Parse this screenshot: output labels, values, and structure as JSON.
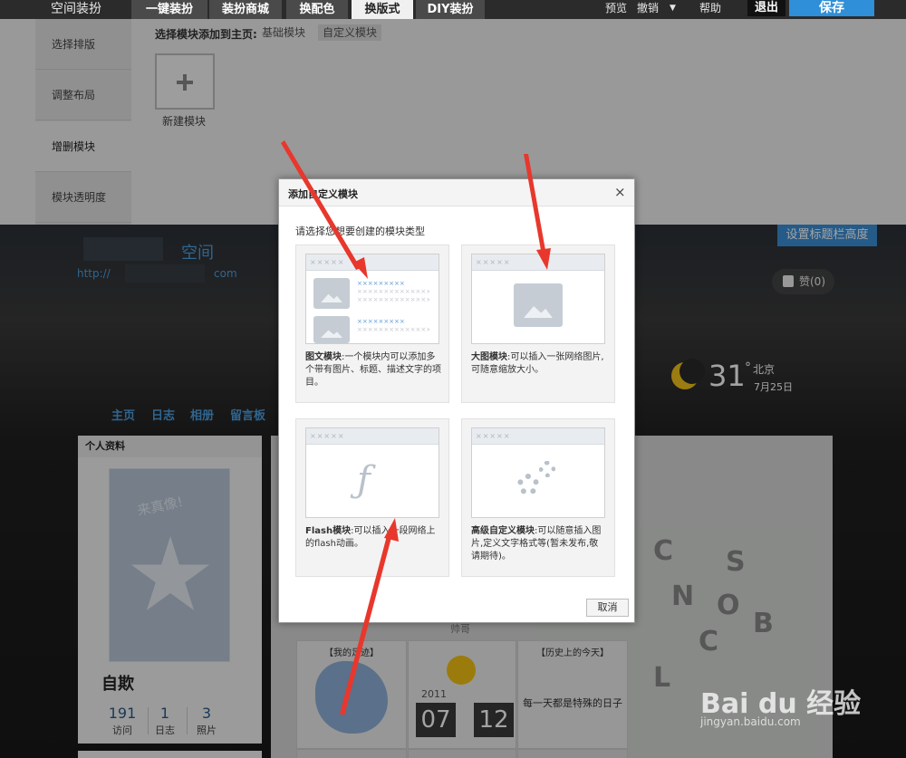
{
  "topbar": {
    "brand": "空间装扮",
    "tabs": [
      "一键装扮",
      "装扮商城",
      "换配色",
      "换版式",
      "DIY装扮"
    ],
    "active_tab": "换版式",
    "preview": "预览",
    "undo": "撤销",
    "help": "帮助",
    "exit": "退出",
    "save": "保存"
  },
  "panel": {
    "side_items": [
      "选择排版",
      "调整布局",
      "增删模块",
      "模块透明度"
    ],
    "active_side": "增删模块",
    "hint": "选择模块添加到主页:",
    "chips": [
      "基础模块",
      "自定义模块"
    ],
    "new_module": "新建模块"
  },
  "space": {
    "title": "空间",
    "url_prefix": "http://",
    "url_suffix": "com",
    "set_height": "设置标题栏高度",
    "like": "赞(0)",
    "temp": "31",
    "deg": "°",
    "city": "北京",
    "date": "7月25日",
    "nav": [
      "主页",
      "日志",
      "相册",
      "留言板"
    ],
    "profile_head": "个人资料",
    "avatar_text": "来真像!",
    "name": "自欺",
    "stats": [
      {
        "num": "191",
        "label": "访问"
      },
      {
        "num": "1",
        "label": "日志"
      },
      {
        "num": "3",
        "label": "照片"
      }
    ],
    "tiles": {
      "t1": "【我的足迹】",
      "t2": "帅哥",
      "t3": "【历史上的今天】",
      "year": "2011",
      "month": "07",
      "day": "12",
      "history_note": "每一天都是特殊的日子"
    }
  },
  "dialog": {
    "title": "添加自定义模块",
    "close": "×",
    "hint": "请选择您想要创建的模块类型",
    "shot_bar": "×××××",
    "cards": [
      {
        "name": "图文模块",
        "desc": ":一个模块内可以添加多个带有图片、标题、描述文字的项目。"
      },
      {
        "name": "大图模块",
        "desc": ":可以插入一张网络图片,可随意缩放大小。"
      },
      {
        "name": "Flash模块",
        "desc": ":可以插入一段网络上的flash动画。"
      },
      {
        "name": "高级自定义模块",
        "desc": ":可以随意插入图片,定义文字格式等(暂未发布,敬请期待)。"
      }
    ],
    "cancel": "取消"
  },
  "watermark": {
    "main": "Bai du 经验",
    "sub": "jingyan.baidu.com"
  },
  "colors": {
    "accent": "#2f8fd8",
    "arrow": "#e8372c",
    "link": "#4b9fe0"
  }
}
